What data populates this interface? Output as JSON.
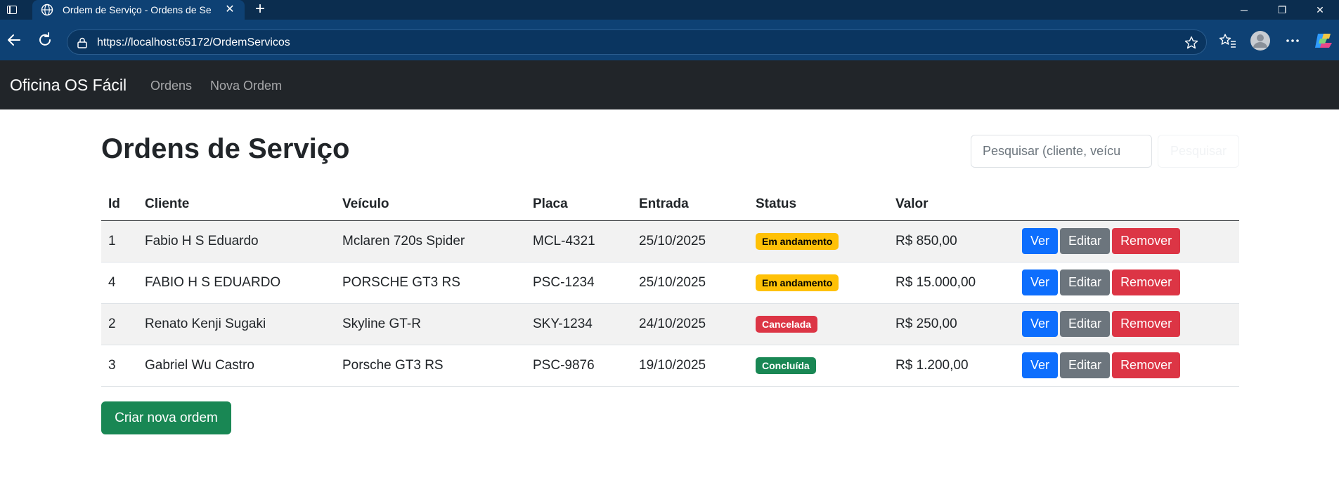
{
  "browser": {
    "tab_title": "Ordem de Serviço - Ordens de Se",
    "url": "https://localhost:65172/OrdemServicos"
  },
  "navbar": {
    "brand": "Oficina OS Fácil",
    "links": [
      "Ordens",
      "Nova Ordem"
    ]
  },
  "main": {
    "title": "Ordens de Serviço",
    "search": {
      "placeholder": "Pesquisar (cliente, veícu",
      "value": "",
      "button_label": "Pesquisar"
    },
    "table": {
      "headers": [
        "Id",
        "Cliente",
        "Veículo",
        "Placa",
        "Entrada",
        "Status",
        "Valor",
        ""
      ],
      "rows": [
        {
          "id": "1",
          "cliente": "Fabio H S Eduardo",
          "veiculo": "Mclaren 720s Spider",
          "placa": "MCL-4321",
          "entrada": "25/10/2025",
          "status": "Em andamento",
          "valor": "R$ 850,00"
        },
        {
          "id": "4",
          "cliente": "FABIO H S EDUARDO",
          "veiculo": "PORSCHE GT3 RS",
          "placa": "PSC-1234",
          "entrada": "25/10/2025",
          "status": "Em andamento",
          "valor": "R$ 15.000,00"
        },
        {
          "id": "2",
          "cliente": "Renato Kenji Sugaki",
          "veiculo": "Skyline GT-R",
          "placa": "SKY-1234",
          "entrada": "24/10/2025",
          "status": "Cancelada",
          "valor": "R$ 250,00"
        },
        {
          "id": "3",
          "cliente": "Gabriel Wu Castro",
          "veiculo": "Porsche GT3 RS",
          "placa": "PSC-9876",
          "entrada": "19/10/2025",
          "status": "Concluída",
          "valor": "R$ 1.200,00"
        }
      ],
      "actions": {
        "view": "Ver",
        "edit": "Editar",
        "remove": "Remover"
      }
    },
    "create_button": "Criar nova ordem"
  },
  "colors": {
    "tabstrip": "#0b2d4f",
    "toolbar": "#0e4174",
    "navbar": "#212529",
    "status_in_progress": "#ffc107",
    "status_cancelled": "#dc3545",
    "status_done": "#198754",
    "btn_primary": "#0d6efd",
    "btn_secondary": "#6c757d",
    "btn_danger": "#dc3545",
    "btn_success": "#198754"
  },
  "icons": {
    "tab_actions": "tab-actions-icon",
    "tab_favicon": "globe-icon",
    "tab_close": "close-icon",
    "new_tab": "plus-icon",
    "back": "back-arrow-icon",
    "refresh": "refresh-icon",
    "site_info": "lock-icon",
    "favorite": "star-icon",
    "favorites": "favorites-icon",
    "profile": "profile-icon",
    "more": "more-icon",
    "copilot": "copilot-icon"
  }
}
